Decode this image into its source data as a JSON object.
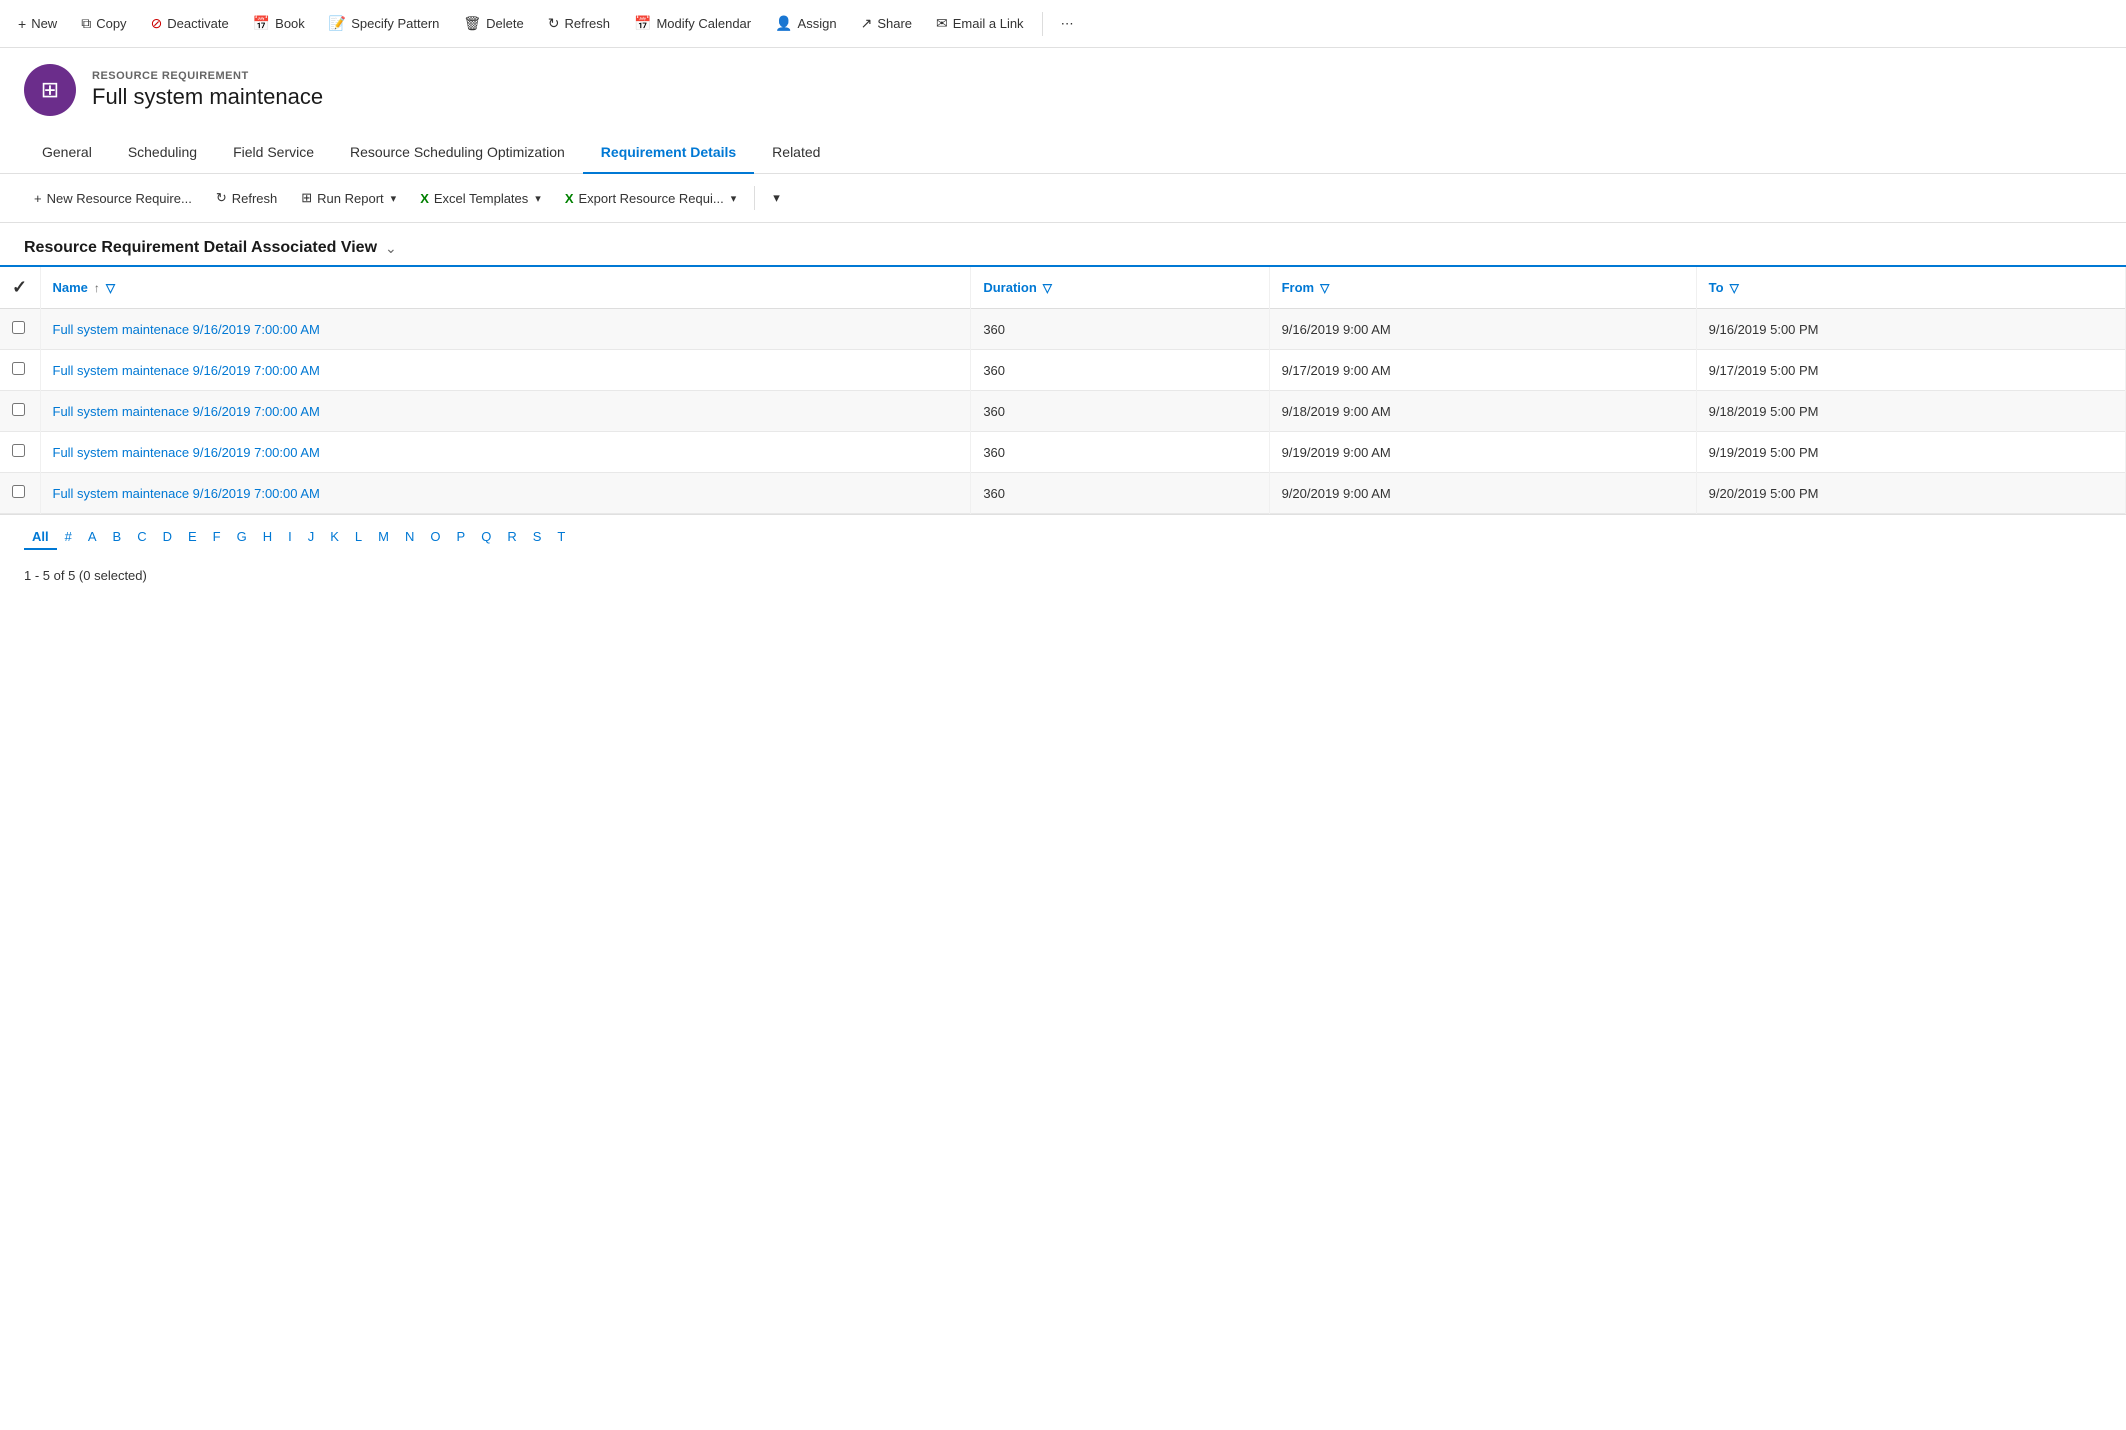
{
  "toolbar": {
    "buttons": [
      {
        "id": "new",
        "label": "New",
        "icon": "+"
      },
      {
        "id": "copy",
        "label": "Copy",
        "icon": "⧉"
      },
      {
        "id": "deactivate",
        "label": "Deactivate",
        "icon": "🚫"
      },
      {
        "id": "book",
        "label": "Book",
        "icon": "📅"
      },
      {
        "id": "specify-pattern",
        "label": "Specify Pattern",
        "icon": "📝"
      },
      {
        "id": "delete",
        "label": "Delete",
        "icon": "🗑"
      },
      {
        "id": "refresh",
        "label": "Refresh",
        "icon": "↻"
      },
      {
        "id": "modify-calendar",
        "label": "Modify Calendar",
        "icon": "📅"
      },
      {
        "id": "assign",
        "label": "Assign",
        "icon": "👤"
      },
      {
        "id": "share",
        "label": "Share",
        "icon": "↗"
      },
      {
        "id": "email-link",
        "label": "Email a Link",
        "icon": "✉"
      }
    ]
  },
  "record": {
    "type": "RESOURCE REQUIREMENT",
    "title": "Full system maintenace",
    "icon": "⊞"
  },
  "tabs": [
    {
      "id": "general",
      "label": "General"
    },
    {
      "id": "scheduling",
      "label": "Scheduling"
    },
    {
      "id": "field-service",
      "label": "Field Service"
    },
    {
      "id": "resource-scheduling",
      "label": "Resource Scheduling Optimization"
    },
    {
      "id": "requirement-details",
      "label": "Requirement Details",
      "active": true
    },
    {
      "id": "related",
      "label": "Related"
    }
  ],
  "sub_toolbar": {
    "buttons": [
      {
        "id": "new-resource",
        "label": "New Resource Require...",
        "icon": "+"
      },
      {
        "id": "sub-refresh",
        "label": "Refresh",
        "icon": "↻"
      },
      {
        "id": "run-report",
        "label": "Run Report",
        "icon": "📊",
        "has_dropdown": true
      },
      {
        "id": "excel-templates",
        "label": "Excel Templates",
        "icon": "⊞",
        "has_dropdown": true
      },
      {
        "id": "export",
        "label": "Export Resource Requi...",
        "icon": "⊞",
        "has_dropdown": true
      }
    ]
  },
  "view": {
    "title": "Resource Requirement Detail Associated View",
    "columns": [
      {
        "id": "name",
        "label": "Name",
        "has_sort": true,
        "has_filter": true
      },
      {
        "id": "duration",
        "label": "Duration",
        "has_filter": true
      },
      {
        "id": "from",
        "label": "From",
        "has_filter": true
      },
      {
        "id": "to",
        "label": "To",
        "has_filter": true
      }
    ],
    "rows": [
      {
        "name": "Full system maintenace 9/16/2019 7:00:00 AM",
        "duration": "360",
        "from": "9/16/2019 9:00 AM",
        "to": "9/16/2019 5:00 PM"
      },
      {
        "name": "Full system maintenace 9/16/2019 7:00:00 AM",
        "duration": "360",
        "from": "9/17/2019 9:00 AM",
        "to": "9/17/2019 5:00 PM"
      },
      {
        "name": "Full system maintenace 9/16/2019 7:00:00 AM",
        "duration": "360",
        "from": "9/18/2019 9:00 AM",
        "to": "9/18/2019 5:00 PM"
      },
      {
        "name": "Full system maintenace 9/16/2019 7:00:00 AM",
        "duration": "360",
        "from": "9/19/2019 9:00 AM",
        "to": "9/19/2019 5:00 PM"
      },
      {
        "name": "Full system maintenace 9/16/2019 7:00:00 AM",
        "duration": "360",
        "from": "9/20/2019 9:00 AM",
        "to": "9/20/2019 5:00 PM"
      }
    ]
  },
  "pagination": {
    "letters": [
      "All",
      "#",
      "A",
      "B",
      "C",
      "D",
      "E",
      "F",
      "G",
      "H",
      "I",
      "J",
      "K",
      "L",
      "M",
      "N",
      "O",
      "P",
      "Q",
      "R",
      "S",
      "T"
    ],
    "active": "All"
  },
  "status": {
    "text": "1 - 5 of 5 (0 selected)"
  },
  "colors": {
    "accent": "#0078d4",
    "icon_bg": "#6b2d8b"
  }
}
